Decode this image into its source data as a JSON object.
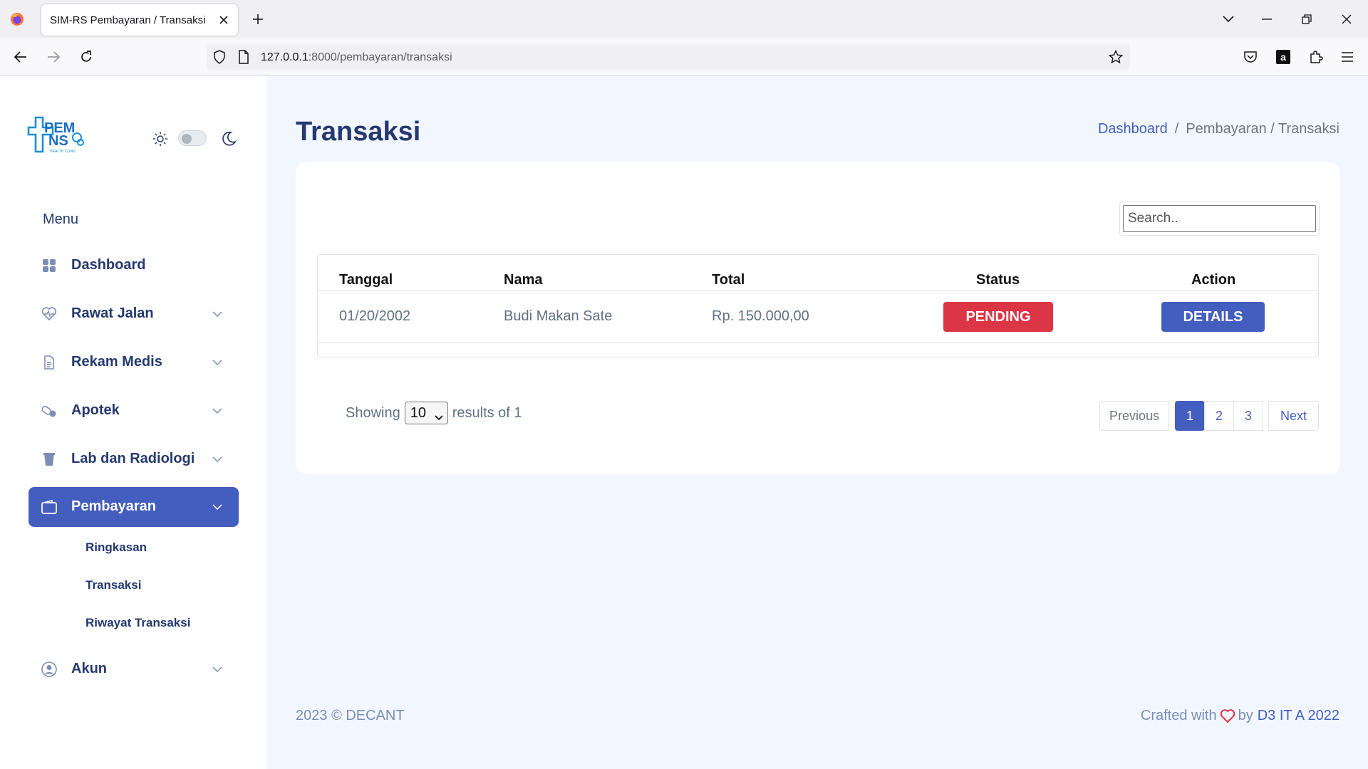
{
  "browser": {
    "tab_title": "SIM-RS Pembayaran / Transaksi",
    "url_host": "127.0.0.1",
    "url_rest": ":8000/pembayaran/transaksi"
  },
  "sidebar": {
    "logo_text_top": "PEM",
    "logo_text_bottom": "NS",
    "logo_caption": "HEALTH CLINIC",
    "menu_title": "Menu",
    "items": [
      {
        "label": "Dashboard",
        "icon": "grid-icon"
      },
      {
        "label": "Rawat Jalan",
        "icon": "heart-pulse-icon"
      },
      {
        "label": "Rekam Medis",
        "icon": "file-text-icon"
      },
      {
        "label": "Apotek",
        "icon": "capsule-icon"
      },
      {
        "label": "Lab dan Radiologi",
        "icon": "cup-icon"
      },
      {
        "label": "Pembayaran",
        "icon": "wallet-icon"
      },
      {
        "label": "Akun",
        "icon": "user-circle-icon"
      }
    ],
    "subitems": [
      "Ringkasan",
      "Transaksi",
      "Riwayat Transaksi"
    ]
  },
  "main": {
    "page_title": "Transaksi",
    "breadcrumb": {
      "home": "Dashboard",
      "current": "Pembayaran / Transaksi"
    },
    "search_placeholder": "Search..",
    "table": {
      "headers": [
        "Tanggal",
        "Nama",
        "Total",
        "Status",
        "Action"
      ],
      "rows": [
        {
          "tanggal": "01/20/2002",
          "nama": "Budi Makan Sate",
          "total": "Rp. 150.000,00",
          "status": "PENDING",
          "action": "DETAILS"
        }
      ]
    },
    "pagination": {
      "showing_prefix": "Showing",
      "per_page": "10",
      "showing_suffix": "results of 1",
      "previous": "Previous",
      "pages": [
        "1",
        "2",
        "3"
      ],
      "next": "Next"
    }
  },
  "footer": {
    "left": "2023 © DECANT",
    "crafted": "Crafted with",
    "by": "by",
    "team": "D3 IT A 2022"
  },
  "colors": {
    "primary": "#435ebe",
    "danger": "#dc3545",
    "text": "#25396f",
    "background": "#f2f7ff"
  }
}
